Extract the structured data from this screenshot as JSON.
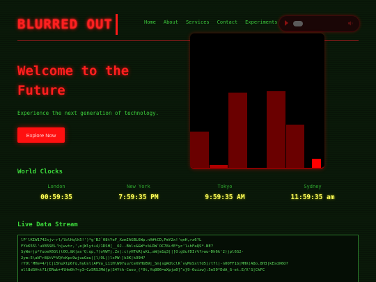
{
  "header": {
    "logo": "BLURRED OUT",
    "nav": [
      "Home",
      "About",
      "Services",
      "Contact",
      "Experiments"
    ]
  },
  "audio_player": {
    "play_icon": "play-icon",
    "volume_icon": "volume-icon"
  },
  "hero": {
    "title": "Welcome to the Future",
    "subtitle": "Experience the next generation of technology.",
    "cta_label": "Explore Now"
  },
  "visualizer": {
    "bar_levels": [
      0.27,
      0.02,
      0.56,
      0.0,
      0.57,
      0.32,
      0.07
    ]
  },
  "clocks": {
    "title": "World Clocks",
    "items": [
      {
        "city": "London",
        "time": "00:59:35"
      },
      {
        "city": "New York",
        "time": "7:59:35 PM"
      },
      {
        "city": "Tokyo",
        "time": "9:59:35 AM"
      },
      {
        "city": "Sydney",
        "time": "11:59:35 am"
      }
    ]
  },
  "stream": {
    "title": "Live Data Stream",
    "lines": [
      "lP'lKIW1742xjv-rl/lblHqlk5!')*g'BJ`08tYeF_XzmIAGBL6Wp.nX#tCD,PmY2x!'qnH,>z6?L",
      "FYkK55l'uV85SEL'h|wvtr,',e|Wlyt+4/1DSH[__OJ--Bbls&&W*s%LRW`OC78+fE*yc'l+hFaQS*-NE?",
      "SyWerjp*fuoeX6Gl(t0O,&K|as'Q:qp,?)oVWTj.Zn|:c)yHTkR|wXi,aW|m1q3||]O:gUufDIr%?>au~Dh6k'2)jpl6S2-",
      "2ym:5\\aN^r8$tV*VQfxKpc9wjuuGeu|[l/OL|)lxPW-]k3K|kO9H?",
      "rYOl'MHe=4/|C|i5huXtp6fq,hyUsl)APVa_L11H\\W97uu/CeXVHbB9|_Sm|sgWdlclK`vyMoSxl7d5j/t7l|-nOOFF1b|MHX(A8o.8H3|kEsdX6O?",
      "oll8dSH<t?1(ERwb+4lHm0h?<y3~Cz5RSJMd{p(S4Yth-Cwoo_(*0t,Yq806=aXpja0]^x}9-6uizw}:5e59*DdA_G-et.E/X'S|CkFC"
    ]
  }
}
